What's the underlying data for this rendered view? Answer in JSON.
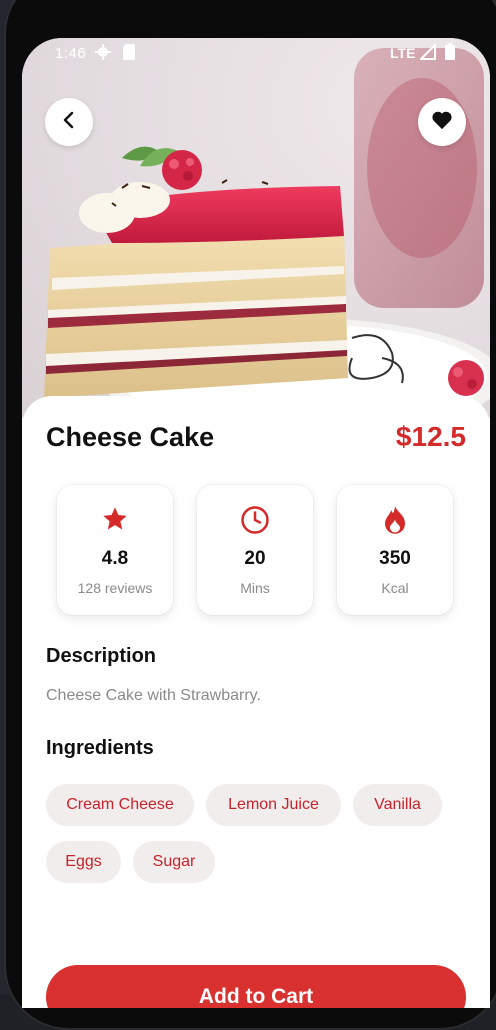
{
  "status_bar": {
    "time": "1:46",
    "network": "LTE"
  },
  "product": {
    "name": "Cheese Cake",
    "price": "$12.5"
  },
  "stats": {
    "rating": {
      "value": "4.8",
      "label": "128 reviews",
      "icon": "star-icon"
    },
    "time": {
      "value": "20",
      "label": "Mins",
      "icon": "clock-icon"
    },
    "calories": {
      "value": "350",
      "label": "Kcal",
      "icon": "flame-icon"
    }
  },
  "description": {
    "heading": "Description",
    "text": "Cheese Cake with Strawbarry."
  },
  "ingredients": {
    "heading": "Ingredients",
    "items": [
      "Cream Cheese",
      "Lemon Juice",
      "Vanilla",
      "Eggs",
      "Sugar"
    ]
  },
  "actions": {
    "add_to_cart": "Add to Cart"
  },
  "colors": {
    "accent": "#d42a2a",
    "button": "#d93030",
    "chip_bg": "#f1eded",
    "chip_text": "#c8232a"
  }
}
